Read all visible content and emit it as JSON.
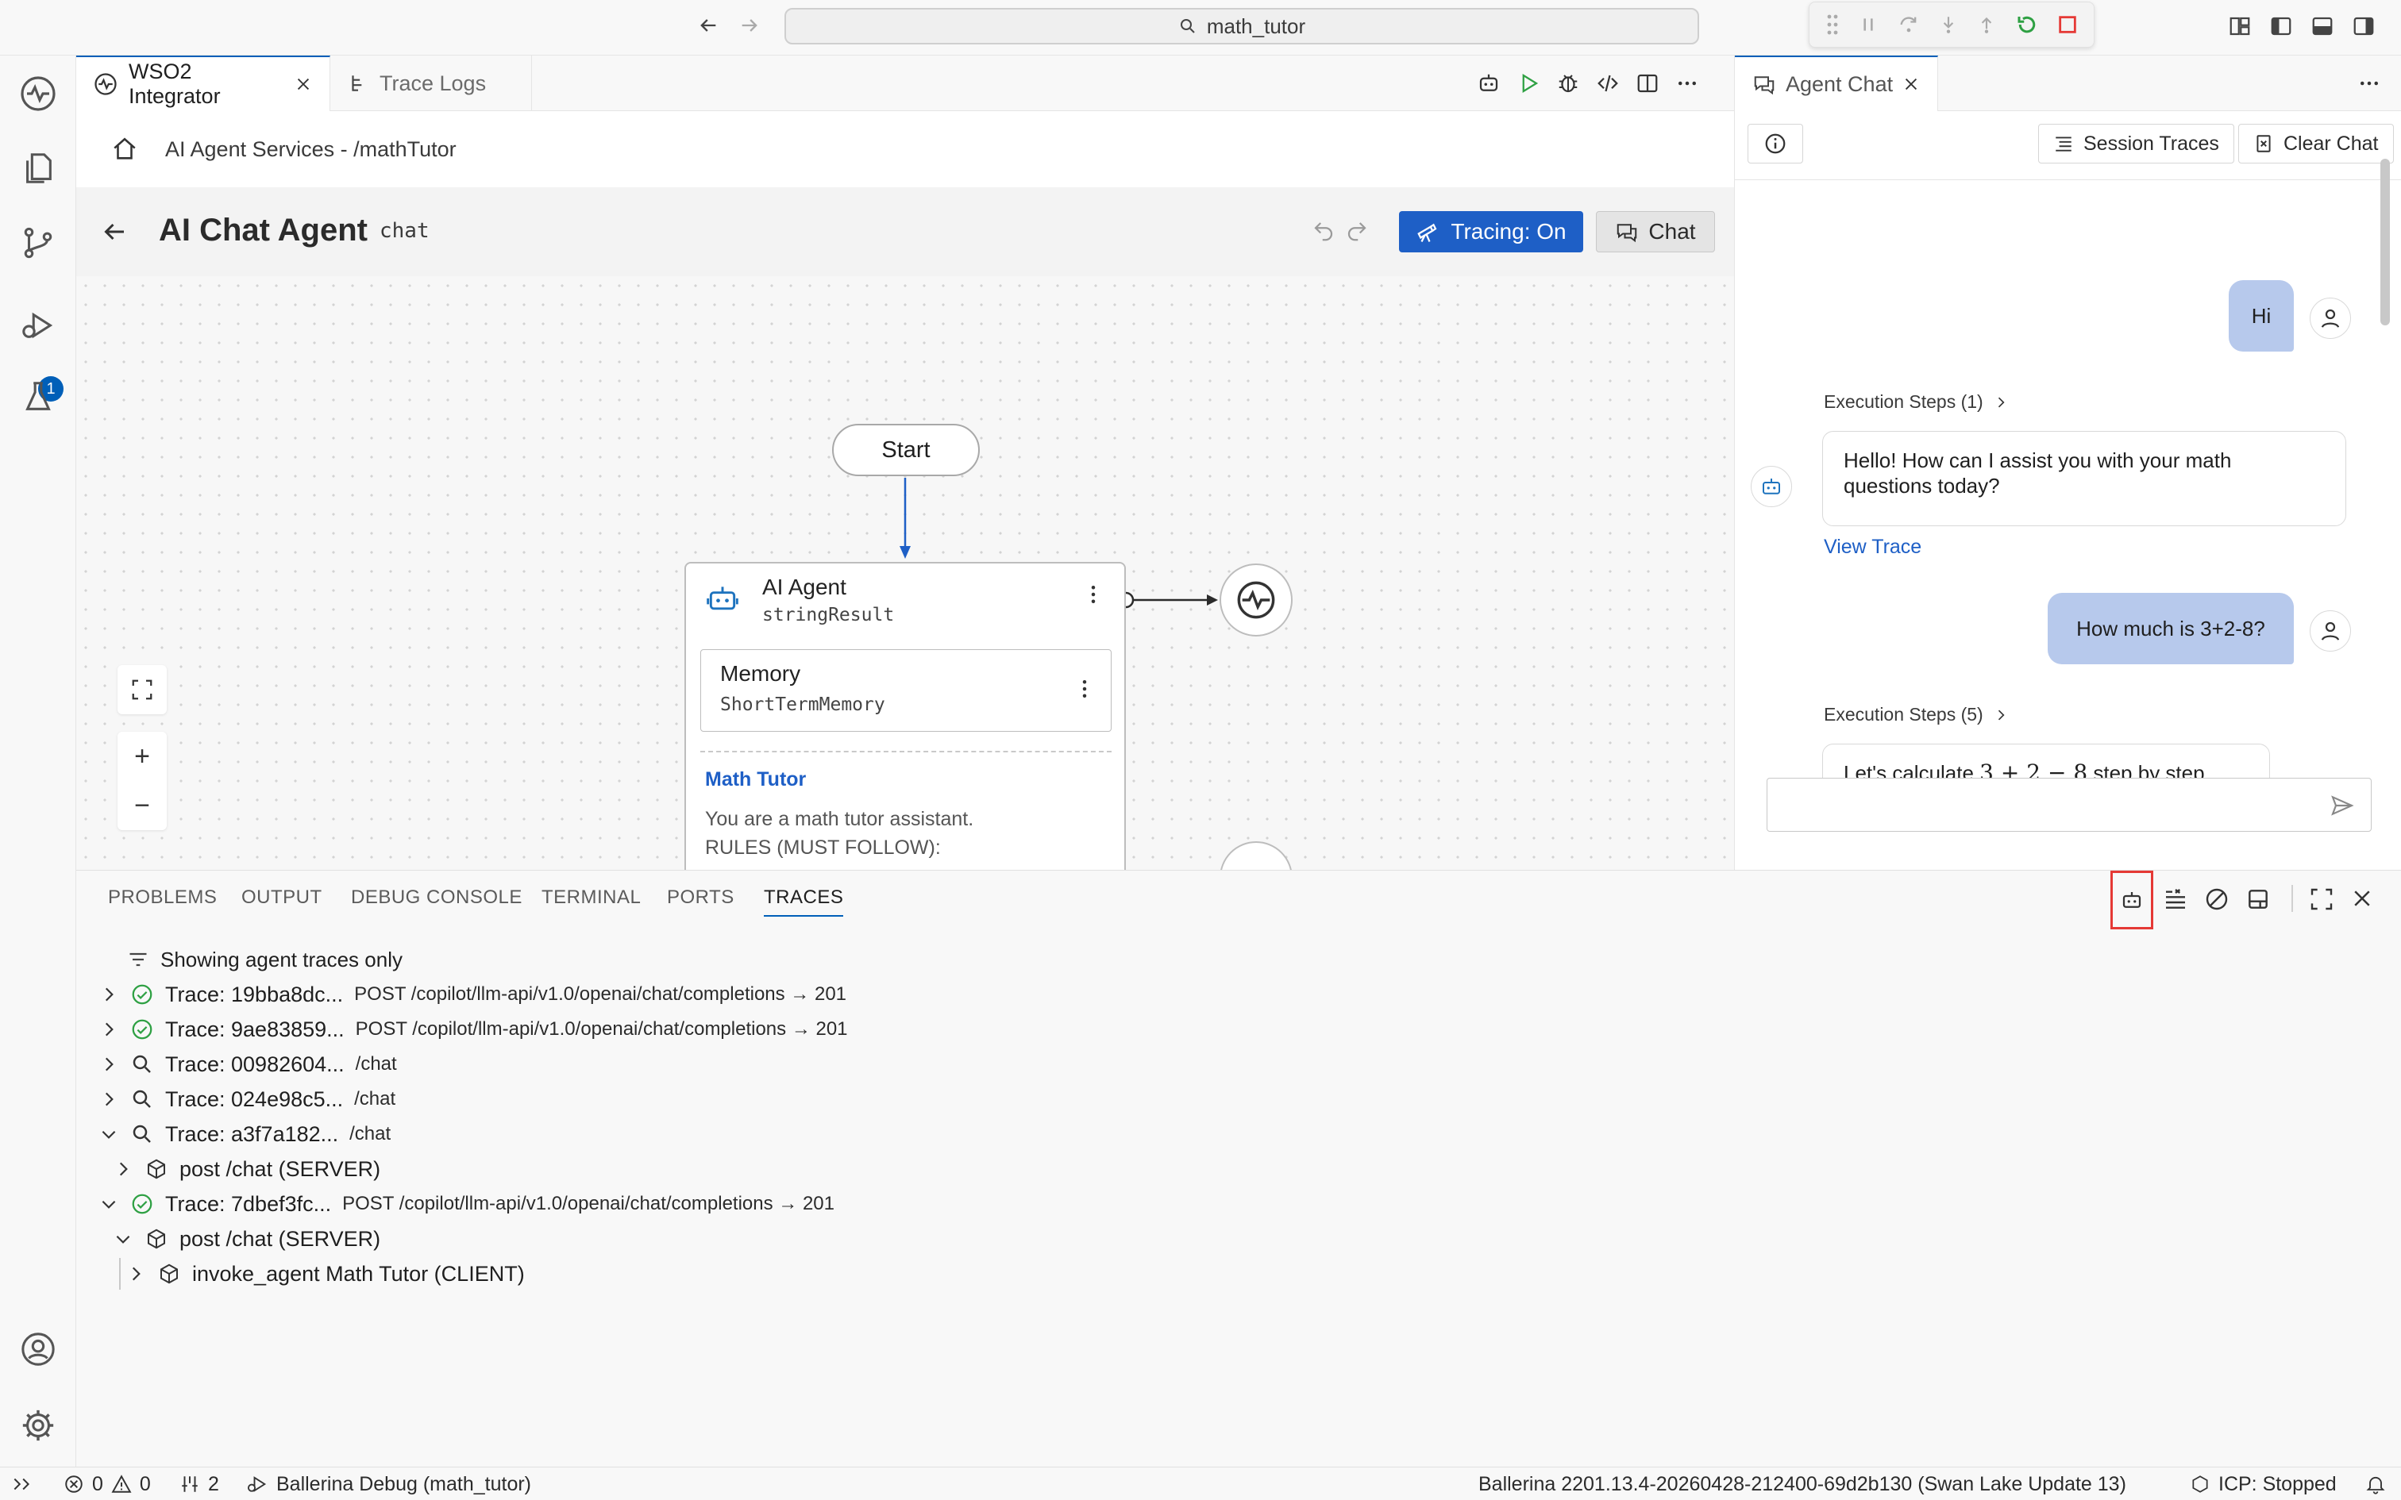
{
  "titlebar": {
    "search_text": "math_tutor"
  },
  "editor": {
    "tabs": [
      {
        "label": "WSO2 Integrator",
        "active": true
      },
      {
        "label": "Trace Logs",
        "active": false
      }
    ],
    "breadcrumb": "AI Agent Services - /mathTutor",
    "page_title": "AI Chat Agent",
    "page_subtitle": "chat",
    "tracing_button": "Tracing: On",
    "chat_button": "Chat"
  },
  "diagram": {
    "start_label": "Start",
    "agent_title": "AI Agent",
    "agent_var": "stringResult",
    "memory_title": "Memory",
    "memory_type": "ShortTermMemory",
    "prompt_role": "Math Tutor",
    "prompt_line1": "You are a math tutor assistant.",
    "prompt_line2": "RULES (MUST FOLLOW):",
    "zoom_in": "+",
    "zoom_out": "−"
  },
  "chat": {
    "tab_label": "Agent Chat",
    "session_traces": "Session Traces",
    "clear_chat": "Clear Chat",
    "messages": [
      {
        "role": "user",
        "text": "Hi"
      },
      {
        "role": "agent",
        "steps": "Execution Steps (1)",
        "text": "Hello! How can I assist you with your math questions today?",
        "link": "View Trace"
      },
      {
        "role": "user",
        "text": "How much is 3+2-8?"
      },
      {
        "role": "agent",
        "steps": "Execution Steps (5)",
        "text_prefix": "Let's calculate ",
        "math": "3 + 2 − 8",
        "text_suffix": " step by step."
      }
    ],
    "input_placeholder": ""
  },
  "panel": {
    "tabs": [
      "PROBLEMS",
      "OUTPUT",
      "DEBUG CONSOLE",
      "TERMINAL",
      "PORTS",
      "TRACES"
    ],
    "active_tab": "TRACES",
    "filter_text": "Showing agent traces only",
    "traces": [
      {
        "id": "Trace: 19bba8dc...",
        "path": "POST /copilot/llm-api/v1.0/openai/chat/completions → 201",
        "status": "success",
        "expanded": false
      },
      {
        "id": "Trace: 9ae83859...",
        "path": "POST /copilot/llm-api/v1.0/openai/chat/completions → 201",
        "status": "success",
        "expanded": false
      },
      {
        "id": "Trace: 00982604...",
        "path": "/chat",
        "status": "search",
        "expanded": false
      },
      {
        "id": "Trace: 024e98c5...",
        "path": "/chat",
        "status": "search",
        "expanded": false
      },
      {
        "id": "Trace: a3f7a182...",
        "path": "/chat",
        "status": "search",
        "expanded": true
      },
      {
        "id": "Trace: 7dbef3fc...",
        "path": "POST /copilot/llm-api/v1.0/openai/chat/completions → 201",
        "status": "success",
        "expanded": true
      }
    ],
    "spans": [
      {
        "label": "post /chat (SERVER)",
        "expanded": false
      },
      {
        "label": "post /chat (SERVER)",
        "expanded": true
      },
      {
        "label": "invoke_agent Math Tutor (CLIENT)",
        "expanded": false
      }
    ]
  },
  "statusbar": {
    "errors": "0",
    "warnings": "0",
    "ports": "2",
    "debug": "Ballerina Debug (math_tutor)",
    "version": "Ballerina 2201.13.4-20260428-212400-69d2b130 (Swan Lake Update 13)",
    "icp": "ICP: Stopped"
  },
  "colors": {
    "accent": "#005fb8",
    "tracing_button": "#1e5fc6",
    "user_bubble": "#b7c9ec",
    "success_green": "#2ea043",
    "highlight_red": "#e53935",
    "link_blue": "#1e5fc6"
  },
  "activity_badge": "1"
}
